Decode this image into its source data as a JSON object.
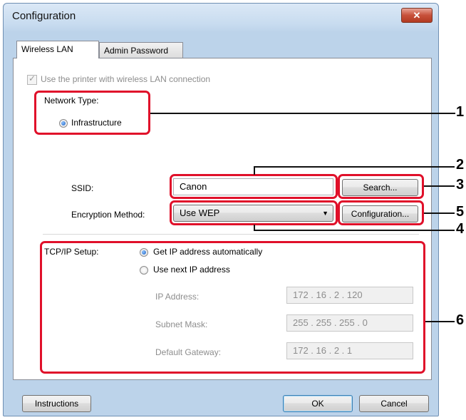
{
  "window": {
    "title": "Configuration",
    "close_symbol": "✕"
  },
  "tabs": [
    {
      "label": "Wireless LAN",
      "active": true
    },
    {
      "label": "Admin Password",
      "active": false
    }
  ],
  "wireless": {
    "use_wireless_label": "Use the printer with wireless LAN connection",
    "use_wireless_checked": true,
    "network_type_label": "Network Type:",
    "infrastructure_label": "Infrastructure",
    "ssid_label": "SSID:",
    "ssid_value": "Canon",
    "search_button": "Search...",
    "encryption_label": "Encryption Method:",
    "encryption_value": "Use WEP",
    "configuration_button": "Configuration..."
  },
  "tcpip": {
    "label": "TCP/IP Setup:",
    "auto_label": "Get IP address automatically",
    "manual_label": "Use next IP address",
    "ip_label": "IP Address:",
    "ip_value": "172 . 16 . 2 . 120",
    "subnet_label": "Subnet Mask:",
    "subnet_value": "255 . 255 . 255 . 0",
    "gateway_label": "Default Gateway:",
    "gateway_value": "172 . 16 . 2 . 1"
  },
  "footer": {
    "instructions": "Instructions",
    "ok": "OK",
    "cancel": "Cancel"
  },
  "callouts": [
    "1",
    "2",
    "3",
    "5",
    "4",
    "6"
  ],
  "colors": {
    "highlight": "#e0102a",
    "close_button": "#c7503a",
    "default_button_border": "#3c7fb1"
  }
}
